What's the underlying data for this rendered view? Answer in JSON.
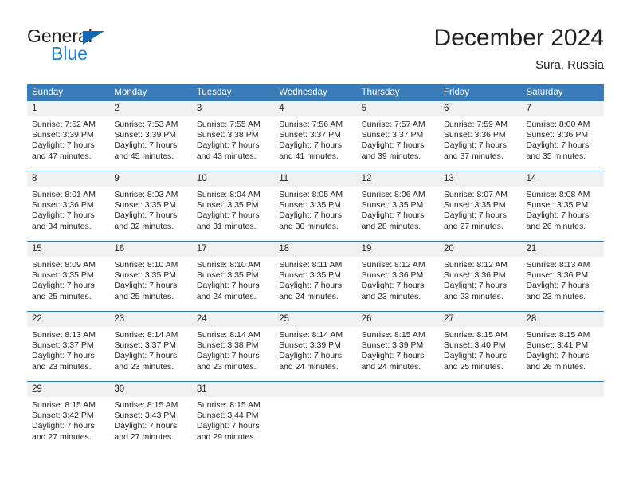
{
  "brand": {
    "name_part1": "General",
    "name_part2": "Blue",
    "triangle_color": "#1268b3",
    "blue_color": "#1f7fd0"
  },
  "header": {
    "title": "December 2024",
    "subtitle": "Sura, Russia"
  },
  "theme": {
    "header_blue": "#3a7cba",
    "row_border_blue": "#2f72b0",
    "daynum_band": "#f0f0f0",
    "text": "#231f20"
  },
  "weekdays": [
    "Sunday",
    "Monday",
    "Tuesday",
    "Wednesday",
    "Thursday",
    "Friday",
    "Saturday"
  ],
  "labels": {
    "sunrise_prefix": "Sunrise: ",
    "sunset_prefix": "Sunset: ",
    "daylight_prefix": "Daylight: "
  },
  "weeks": [
    [
      {
        "day": "1",
        "sunrise": "Sunrise: 7:52 AM",
        "sunset": "Sunset: 3:39 PM",
        "daylight1": "Daylight: 7 hours",
        "daylight2": "and 47 minutes."
      },
      {
        "day": "2",
        "sunrise": "Sunrise: 7:53 AM",
        "sunset": "Sunset: 3:39 PM",
        "daylight1": "Daylight: 7 hours",
        "daylight2": "and 45 minutes."
      },
      {
        "day": "3",
        "sunrise": "Sunrise: 7:55 AM",
        "sunset": "Sunset: 3:38 PM",
        "daylight1": "Daylight: 7 hours",
        "daylight2": "and 43 minutes."
      },
      {
        "day": "4",
        "sunrise": "Sunrise: 7:56 AM",
        "sunset": "Sunset: 3:37 PM",
        "daylight1": "Daylight: 7 hours",
        "daylight2": "and 41 minutes."
      },
      {
        "day": "5",
        "sunrise": "Sunrise: 7:57 AM",
        "sunset": "Sunset: 3:37 PM",
        "daylight1": "Daylight: 7 hours",
        "daylight2": "and 39 minutes."
      },
      {
        "day": "6",
        "sunrise": "Sunrise: 7:59 AM",
        "sunset": "Sunset: 3:36 PM",
        "daylight1": "Daylight: 7 hours",
        "daylight2": "and 37 minutes."
      },
      {
        "day": "7",
        "sunrise": "Sunrise: 8:00 AM",
        "sunset": "Sunset: 3:36 PM",
        "daylight1": "Daylight: 7 hours",
        "daylight2": "and 35 minutes."
      }
    ],
    [
      {
        "day": "8",
        "sunrise": "Sunrise: 8:01 AM",
        "sunset": "Sunset: 3:36 PM",
        "daylight1": "Daylight: 7 hours",
        "daylight2": "and 34 minutes."
      },
      {
        "day": "9",
        "sunrise": "Sunrise: 8:03 AM",
        "sunset": "Sunset: 3:35 PM",
        "daylight1": "Daylight: 7 hours",
        "daylight2": "and 32 minutes."
      },
      {
        "day": "10",
        "sunrise": "Sunrise: 8:04 AM",
        "sunset": "Sunset: 3:35 PM",
        "daylight1": "Daylight: 7 hours",
        "daylight2": "and 31 minutes."
      },
      {
        "day": "11",
        "sunrise": "Sunrise: 8:05 AM",
        "sunset": "Sunset: 3:35 PM",
        "daylight1": "Daylight: 7 hours",
        "daylight2": "and 30 minutes."
      },
      {
        "day": "12",
        "sunrise": "Sunrise: 8:06 AM",
        "sunset": "Sunset: 3:35 PM",
        "daylight1": "Daylight: 7 hours",
        "daylight2": "and 28 minutes."
      },
      {
        "day": "13",
        "sunrise": "Sunrise: 8:07 AM",
        "sunset": "Sunset: 3:35 PM",
        "daylight1": "Daylight: 7 hours",
        "daylight2": "and 27 minutes."
      },
      {
        "day": "14",
        "sunrise": "Sunrise: 8:08 AM",
        "sunset": "Sunset: 3:35 PM",
        "daylight1": "Daylight: 7 hours",
        "daylight2": "and 26 minutes."
      }
    ],
    [
      {
        "day": "15",
        "sunrise": "Sunrise: 8:09 AM",
        "sunset": "Sunset: 3:35 PM",
        "daylight1": "Daylight: 7 hours",
        "daylight2": "and 25 minutes."
      },
      {
        "day": "16",
        "sunrise": "Sunrise: 8:10 AM",
        "sunset": "Sunset: 3:35 PM",
        "daylight1": "Daylight: 7 hours",
        "daylight2": "and 25 minutes."
      },
      {
        "day": "17",
        "sunrise": "Sunrise: 8:10 AM",
        "sunset": "Sunset: 3:35 PM",
        "daylight1": "Daylight: 7 hours",
        "daylight2": "and 24 minutes."
      },
      {
        "day": "18",
        "sunrise": "Sunrise: 8:11 AM",
        "sunset": "Sunset: 3:35 PM",
        "daylight1": "Daylight: 7 hours",
        "daylight2": "and 24 minutes."
      },
      {
        "day": "19",
        "sunrise": "Sunrise: 8:12 AM",
        "sunset": "Sunset: 3:36 PM",
        "daylight1": "Daylight: 7 hours",
        "daylight2": "and 23 minutes."
      },
      {
        "day": "20",
        "sunrise": "Sunrise: 8:12 AM",
        "sunset": "Sunset: 3:36 PM",
        "daylight1": "Daylight: 7 hours",
        "daylight2": "and 23 minutes."
      },
      {
        "day": "21",
        "sunrise": "Sunrise: 8:13 AM",
        "sunset": "Sunset: 3:36 PM",
        "daylight1": "Daylight: 7 hours",
        "daylight2": "and 23 minutes."
      }
    ],
    [
      {
        "day": "22",
        "sunrise": "Sunrise: 8:13 AM",
        "sunset": "Sunset: 3:37 PM",
        "daylight1": "Daylight: 7 hours",
        "daylight2": "and 23 minutes."
      },
      {
        "day": "23",
        "sunrise": "Sunrise: 8:14 AM",
        "sunset": "Sunset: 3:37 PM",
        "daylight1": "Daylight: 7 hours",
        "daylight2": "and 23 minutes."
      },
      {
        "day": "24",
        "sunrise": "Sunrise: 8:14 AM",
        "sunset": "Sunset: 3:38 PM",
        "daylight1": "Daylight: 7 hours",
        "daylight2": "and 23 minutes."
      },
      {
        "day": "25",
        "sunrise": "Sunrise: 8:14 AM",
        "sunset": "Sunset: 3:39 PM",
        "daylight1": "Daylight: 7 hours",
        "daylight2": "and 24 minutes."
      },
      {
        "day": "26",
        "sunrise": "Sunrise: 8:15 AM",
        "sunset": "Sunset: 3:39 PM",
        "daylight1": "Daylight: 7 hours",
        "daylight2": "and 24 minutes."
      },
      {
        "day": "27",
        "sunrise": "Sunrise: 8:15 AM",
        "sunset": "Sunset: 3:40 PM",
        "daylight1": "Daylight: 7 hours",
        "daylight2": "and 25 minutes."
      },
      {
        "day": "28",
        "sunrise": "Sunrise: 8:15 AM",
        "sunset": "Sunset: 3:41 PM",
        "daylight1": "Daylight: 7 hours",
        "daylight2": "and 26 minutes."
      }
    ],
    [
      {
        "day": "29",
        "sunrise": "Sunrise: 8:15 AM",
        "sunset": "Sunset: 3:42 PM",
        "daylight1": "Daylight: 7 hours",
        "daylight2": "and 27 minutes."
      },
      {
        "day": "30",
        "sunrise": "Sunrise: 8:15 AM",
        "sunset": "Sunset: 3:43 PM",
        "daylight1": "Daylight: 7 hours",
        "daylight2": "and 27 minutes."
      },
      {
        "day": "31",
        "sunrise": "Sunrise: 8:15 AM",
        "sunset": "Sunset: 3:44 PM",
        "daylight1": "Daylight: 7 hours",
        "daylight2": "and 29 minutes."
      },
      {
        "day": "",
        "sunrise": "",
        "sunset": "",
        "daylight1": "",
        "daylight2": ""
      },
      {
        "day": "",
        "sunrise": "",
        "sunset": "",
        "daylight1": "",
        "daylight2": ""
      },
      {
        "day": "",
        "sunrise": "",
        "sunset": "",
        "daylight1": "",
        "daylight2": ""
      },
      {
        "day": "",
        "sunrise": "",
        "sunset": "",
        "daylight1": "",
        "daylight2": ""
      }
    ]
  ]
}
